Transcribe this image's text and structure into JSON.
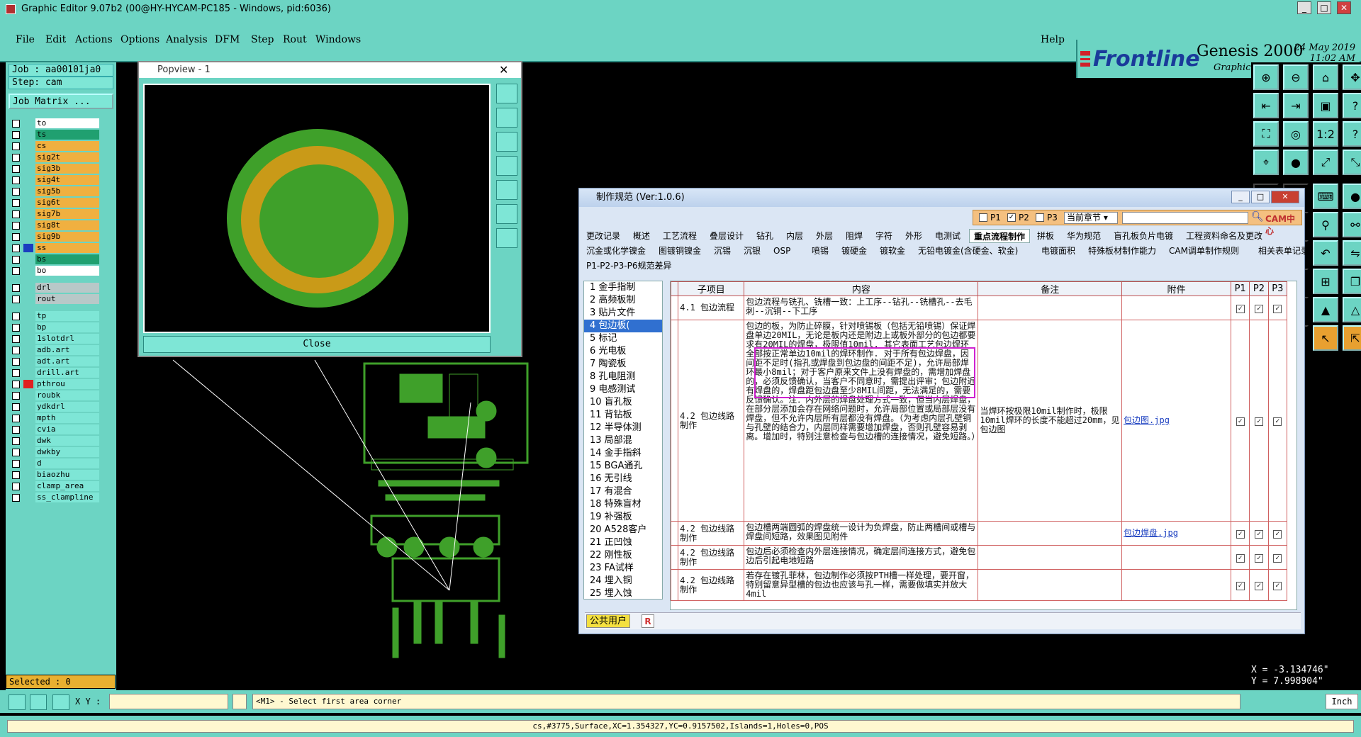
{
  "window": {
    "title": "Graphic Editor 9.07b2 (00@HY-HYCAM-PC185 - Windows, pid:6036)"
  },
  "menu": [
    "File",
    "Edit",
    "Actions",
    "Options",
    "Analysis",
    "DFM",
    "Step",
    "Rout",
    "Windows"
  ],
  "help_label": "Help",
  "brand": {
    "logo": "Frontline",
    "product": "Genesis 2000",
    "subtitle": "Graphic Editor",
    "date": "24 May 2019",
    "time": "11:02 AM"
  },
  "job": {
    "job_label": "Job : aa00101ja0",
    "step_label": "Step: cam",
    "matrix_button": "Job Matrix ..."
  },
  "layers": [
    {
      "name": "to",
      "color": "#ffffff"
    },
    {
      "name": "ts",
      "color": "#20a070"
    },
    {
      "name": "cs",
      "color": "#f0b040"
    },
    {
      "name": "sig2t",
      "color": "#f0b040"
    },
    {
      "name": "sig3b",
      "color": "#f0b040"
    },
    {
      "name": "sig4t",
      "color": "#f0b040"
    },
    {
      "name": "sig5b",
      "color": "#f0b040"
    },
    {
      "name": "sig6t",
      "color": "#f0b040"
    },
    {
      "name": "sig7b",
      "color": "#f0b040"
    },
    {
      "name": "sig8t",
      "color": "#f0b040"
    },
    {
      "name": "sig9b",
      "color": "#f0b040"
    },
    {
      "name": "ss",
      "color": "#f0b040"
    },
    {
      "name": "bs",
      "color": "#20a070"
    },
    {
      "name": "bo",
      "color": "#ffffff"
    },
    {
      "name": "drl",
      "color": "#b8c8c8"
    },
    {
      "name": "rout",
      "color": "#b8c8c8"
    },
    {
      "name": "tp",
      "color": "#7ee6d6"
    },
    {
      "name": "bp",
      "color": "#7ee6d6"
    },
    {
      "name": "1slotdrl",
      "color": "#7ee6d6"
    },
    {
      "name": "adb.art",
      "color": "#7ee6d6"
    },
    {
      "name": "adt.art",
      "color": "#7ee6d6"
    },
    {
      "name": "drill.art",
      "color": "#7ee6d6"
    },
    {
      "name": "pthrou",
      "color": "#7ee6d6"
    },
    {
      "name": "roubk",
      "color": "#7ee6d6"
    },
    {
      "name": "ydkdrl",
      "color": "#7ee6d6"
    },
    {
      "name": "mpth",
      "color": "#7ee6d6"
    },
    {
      "name": "cvia",
      "color": "#7ee6d6"
    },
    {
      "name": "dwk",
      "color": "#7ee6d6"
    },
    {
      "name": "dwkby",
      "color": "#7ee6d6"
    },
    {
      "name": "d",
      "color": "#7ee6d6"
    },
    {
      "name": "biaozhu",
      "color": "#7ee6d6"
    },
    {
      "name": "clamp_area",
      "color": "#7ee6d6"
    },
    {
      "name": "ss_clampline",
      "color": "#7ee6d6"
    }
  ],
  "selected_label": "Selected : 0",
  "popview": {
    "title": "Popview - 1",
    "close_label": "Close"
  },
  "spec_window": {
    "title": "制作规范 (Ver:1.0.6)",
    "filter": {
      "p1": "P1",
      "p2": "P2",
      "p3": "P3",
      "scope": "当前章节",
      "cam_center": "CAM中心"
    },
    "tabs_row1": [
      "更改记录",
      "概述",
      "工艺流程",
      "叠层设计",
      "钻孔",
      "内层",
      "外层",
      "阻焊",
      "字符",
      "外形",
      "电测试",
      "重点流程制作",
      "拼板",
      "华为规范",
      "盲孔板负片电镀",
      "工程资料命名及更改"
    ],
    "tabs_row2": [
      "沉金或化学镍金",
      "图镀铜镍金",
      "沉锡",
      "沉银",
      "OSP",
      "喷锡",
      "镀硬金",
      "镀软金",
      "无铅电镀金(含硬金、软金)",
      "电镀面积",
      "特殊板材制作能力",
      "CAM调单制作规则",
      "相关表单记录"
    ],
    "tabs_row3": [
      "P1-P2-P3-P6规范差异"
    ],
    "nav": [
      "1 金手指制",
      "2 高频板制",
      "3 贴片文件",
      "4 包边板(",
      "5 标记",
      "6 光电板",
      "7 陶瓷板",
      "8 孔电阻测",
      "9 电感测试",
      "10 盲孔板",
      "11 背钻板",
      "12 半导体测",
      "13 局部混",
      "14 金手指斜",
      "15 BGA通孔",
      "16 无引线",
      "17 有混合",
      "18 特殊盲材",
      "19 补强板",
      "20 A528客户",
      "21 正凹蚀",
      "22 刚性板",
      "23 FA试样",
      "24 埋入铜",
      "25 埋入蚀"
    ],
    "columns": [
      "子项目",
      "内容",
      "备注",
      "附件",
      "P1",
      "P2",
      "P3"
    ],
    "rows": [
      {
        "item": "4.1 包边流程",
        "content": "包边流程与铣孔、铣槽一致：上工序--钻孔--铣槽孔--去毛刺--沉铜--下工序",
        "note": "",
        "attach": ""
      },
      {
        "item": "4.2 包边线路制作",
        "content": "包边的板，为防止碎膜，针对喷锡板（包括无铅喷锡）保证焊盘单边20MIL，无论是板内还是附边上或板外部分的包边都要求有20MIL的焊盘，极限值10mil. 其它表面工艺包边焊环全部按正常单边10mil的焊环制作. 对于所有包边焊盘，因间距不足时(指孔或焊盘到包边盘的间距不足)，允许局部焊环最小8mil；对于客户原来文件上没有焊盘的，需增加焊盘的，必须反馈确认，当客户不同意时，需提出评审；包边附近有焊盘的，焊盘距包边盘至少8MIL间距，无法满足的，需要反馈确认。注：内外层的焊盘处理方式一致，但当内层焊盘，在部分层添加会存在网络问题时，允许局部位置或局部层没有焊盘，但不允许内层所有层都没有焊盘。（为考虑内层孔壁铜与孔壁的结合力，内层同样需要增加焊盘，否则孔壁容易剥离。增加时，特别注意检查与包边槽的连接情况，避免短路。）",
        "note": "当焊环按极限10mil制作时，极限10mil焊环的长度不能超过20mm，见包边图",
        "attach": "包边图.jpg"
      },
      {
        "item": "4.2 包边线路制作",
        "content": "包边槽两端圆弧的焊盘统一设计为负焊盘，防止两槽间或槽与焊盘间短路，效果图见附件",
        "note": "",
        "attach": "包边焊盘.jpg"
      },
      {
        "item": "4.2 包边线路制作",
        "content": "包边后必须检查内外层连接情况，确定层间连接方式，避免包边后引起电地短路",
        "note": "",
        "attach": ""
      },
      {
        "item": "4.2 包边线路制作",
        "content": "若存在镀孔菲林，包边制作必须按PTH槽一样处理，要开窗，特别留意异型槽的包边也应该与孔一样，需要做填实并放大4mil",
        "note": "",
        "attach": ""
      }
    ],
    "user_label": "公共用户",
    "user_badge": "R"
  },
  "status": {
    "xy_label": "X Y :",
    "xy_value": "",
    "prompt": "<M1> - Select first area corner",
    "unit": "Inch"
  },
  "coords": {
    "x": "X = -3.134746\"",
    "y": "Y = 7.998904\""
  },
  "bottom_info": "cs,#3775,Surface,XC=1.354327,YC=0.9157502,Islands=1,Holes=0,POS",
  "colors": {
    "app_bg": "#6cd4c3",
    "board_green": "#3fa02a",
    "ring_gold": "#c99a18",
    "highlight_magenta": "#d020d0"
  }
}
